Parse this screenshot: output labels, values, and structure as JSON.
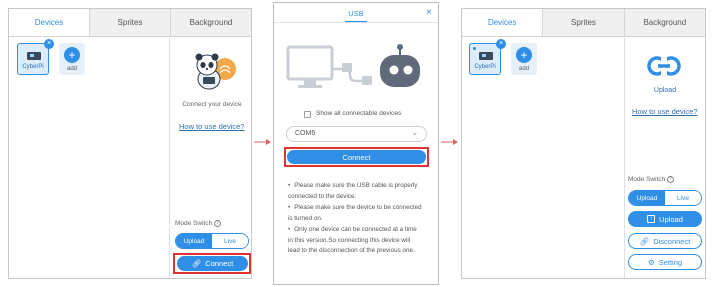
{
  "panel1": {
    "tabs": [
      "Devices",
      "Sprites",
      "Background"
    ],
    "device_label": "CyberPi",
    "add_label": "add",
    "connect_prompt": "Connect your device",
    "how_to_link": "How to use device?",
    "mode_switch_label": "Mode Switch",
    "mode_options": [
      "Upload",
      "Live"
    ],
    "connect_button": "Connect"
  },
  "usb_dialog": {
    "title": "USB",
    "close_glyph": "×",
    "checkbox_label": "Show all connectable devices",
    "port_value": "COM6",
    "connect_button": "Connect",
    "notes": [
      "Please make sure the USB cable is properly connected to the device.",
      "Please make sure the device to be connected is turned on.",
      "Only one device can be connected at a time in this version.So connecting this device will lead to the disconnection of the previous one."
    ]
  },
  "panel3": {
    "tabs": [
      "Devices",
      "Sprites",
      "Background"
    ],
    "device_label": "CyberPi",
    "add_label": "add",
    "upload_caption": "Upload",
    "how_to_link": "How to use device?",
    "mode_switch_label": "Mode Switch",
    "mode_options": [
      "Upload",
      "Live"
    ],
    "upload_button": "Upload",
    "disconnect_button": "Disconnect",
    "setting_button": "Setting"
  },
  "colors": {
    "accent": "#2f8fe6",
    "highlight": "#dd3333",
    "arrow": "#e06060"
  }
}
